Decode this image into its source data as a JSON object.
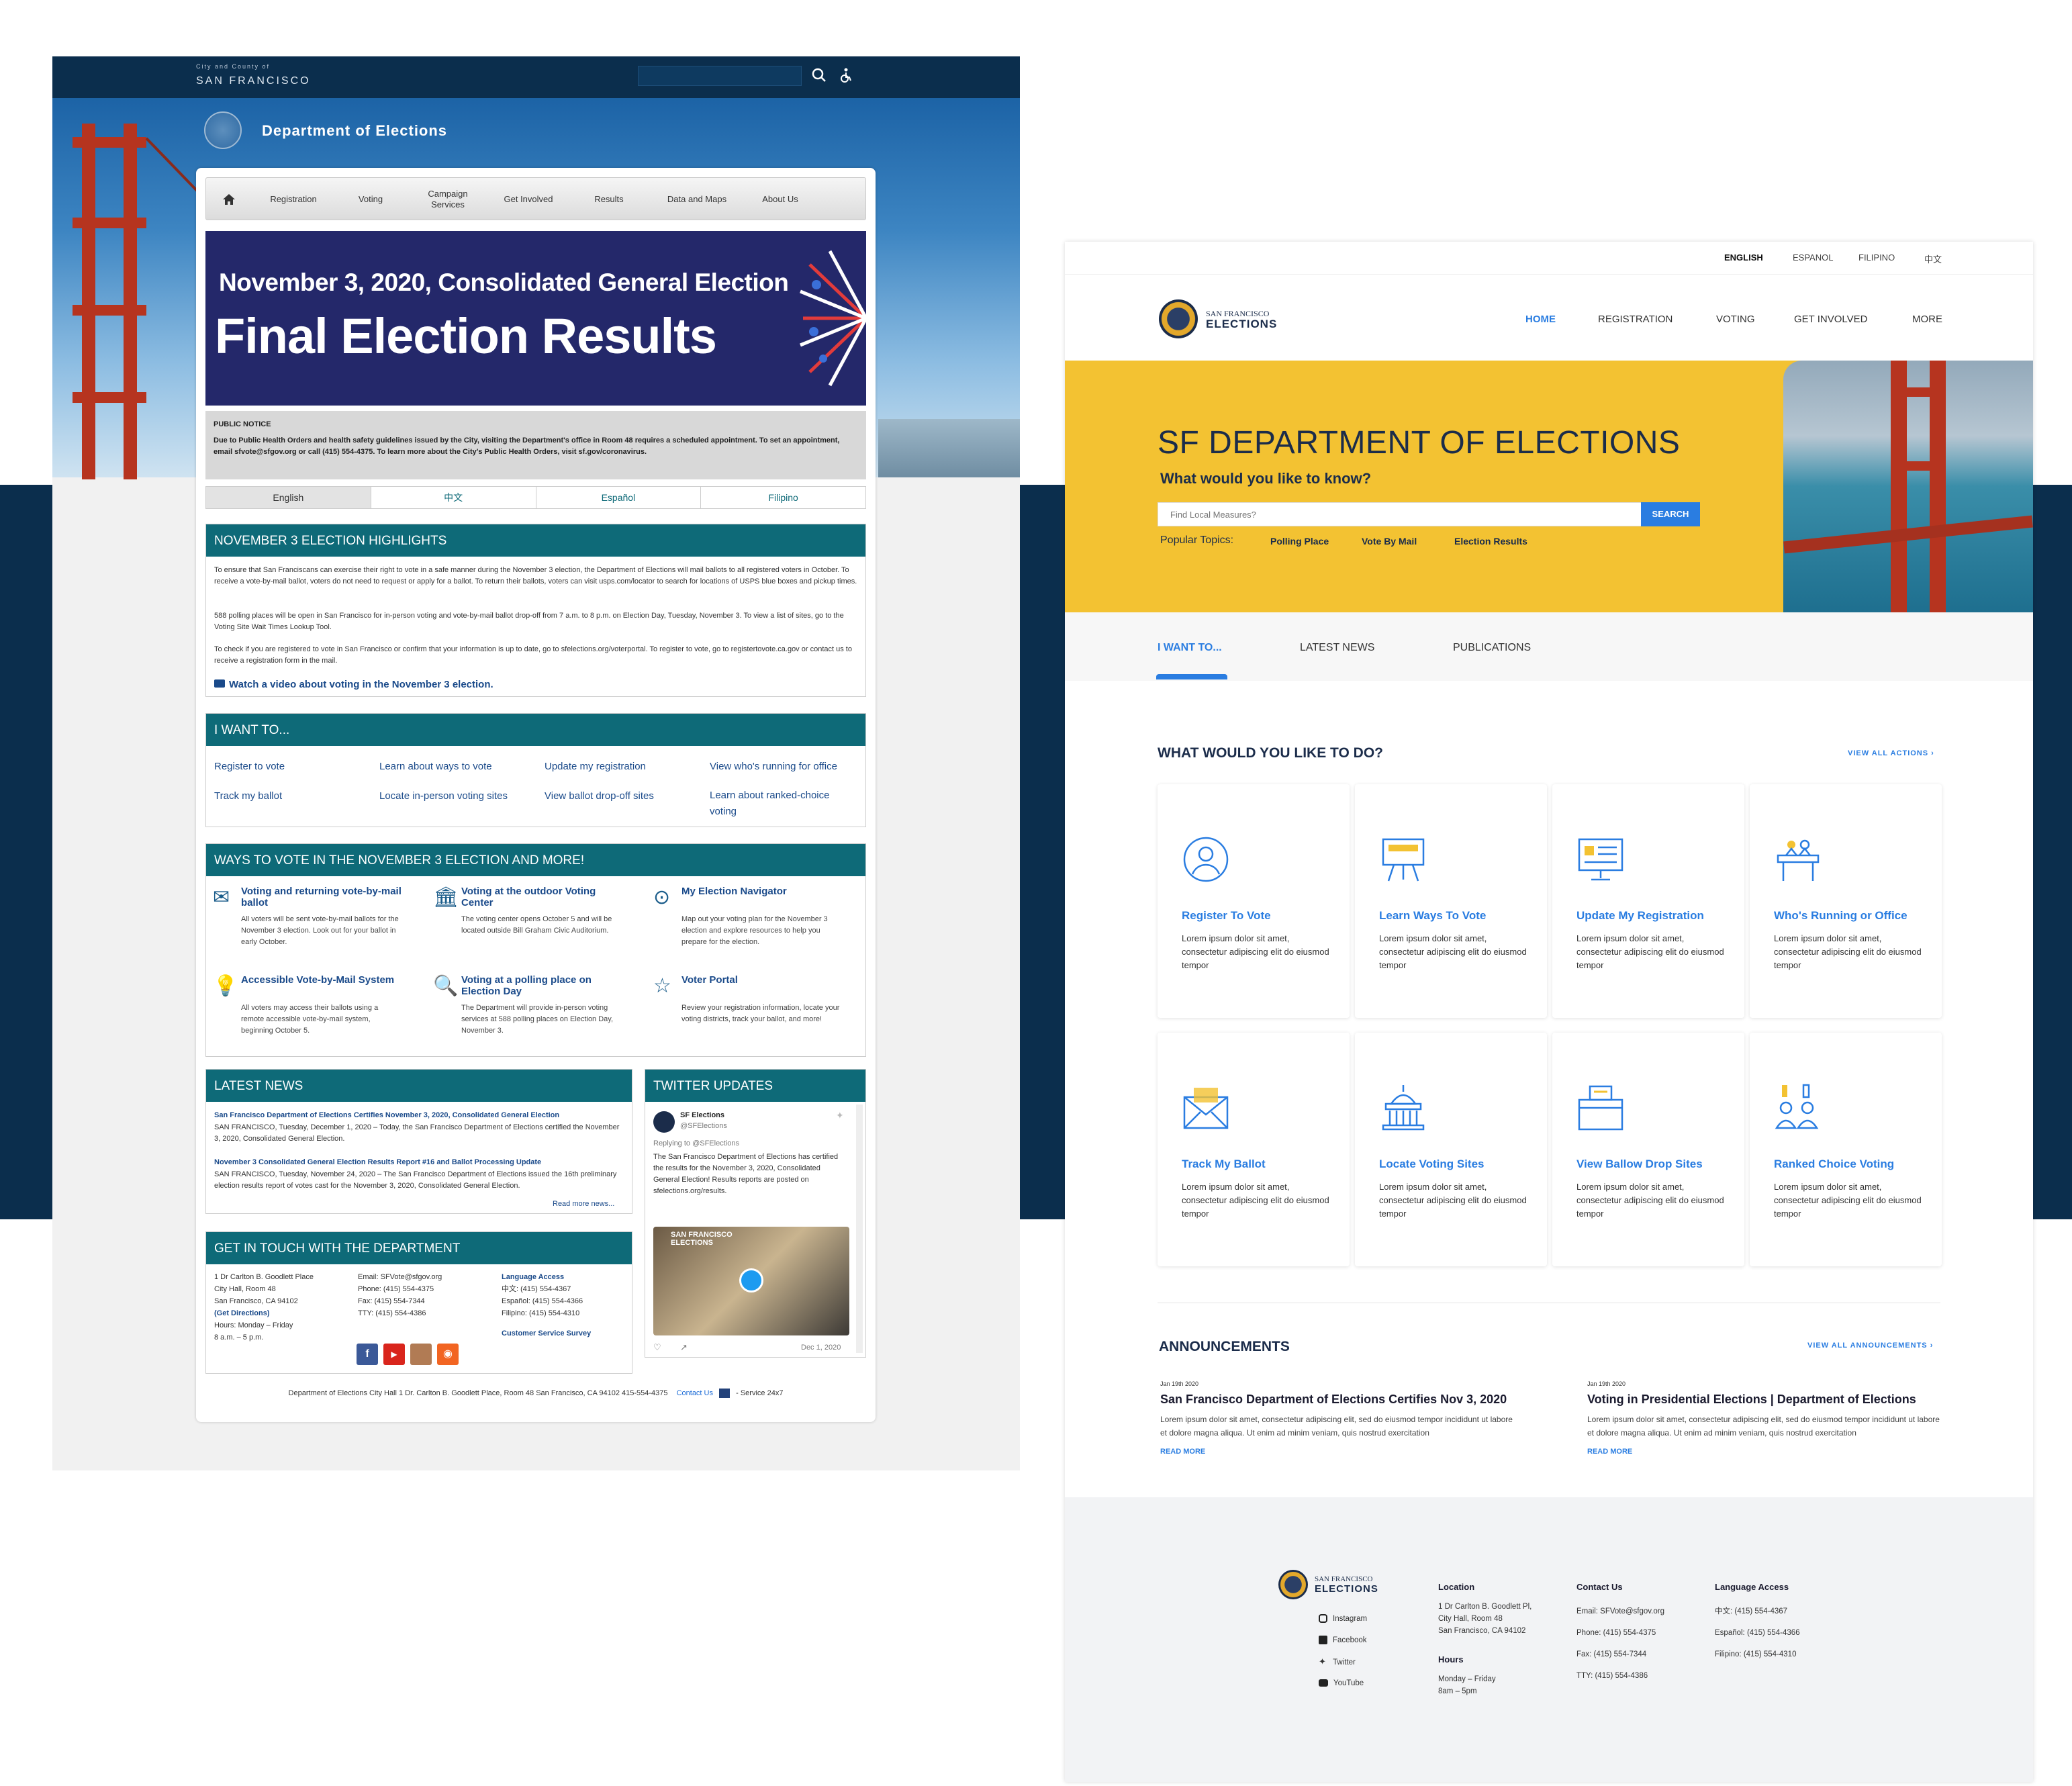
{
  "old_site": {
    "header": {
      "city_small": "City and County of",
      "city_big": "SAN FRANCISCO",
      "dept_title": "Department of Elections"
    },
    "nav": [
      "Registration",
      "Voting",
      "Campaign Services",
      "Get Involved",
      "Results",
      "Data and Maps",
      "About Us"
    ],
    "banner": {
      "line1": "November 3, 2020, Consolidated General Election",
      "line2": "Final Election Results"
    },
    "notice": {
      "title": "PUBLIC NOTICE",
      "text": "Due to Public Health Orders and health safety guidelines issued by the City, visiting the Department's office in Room 48 requires a scheduled appointment. To set an appointment, email sfvote@sfgov.org or call (415) 554-4375. To learn more about the City's Public Health Orders, visit sf.gov/coronavirus."
    },
    "languages": [
      "English",
      "中文",
      "Español",
      "Filipino"
    ],
    "highlights": {
      "title": "NOVEMBER 3 ELECTION HIGHLIGHTS",
      "p1": "To ensure that San Franciscans can exercise their right to vote in a safe manner during the November 3 election, the Department of Elections will mail ballots to all registered voters in October. To receive a vote-by-mail ballot, voters do not need to request or apply for a ballot. To return their ballots, voters can visit usps.com/locator to search for locations of USPS blue boxes and pickup times.",
      "p2": "588 polling places will be open in San Francisco for in-person voting and vote-by-mail ballot drop-off from 7 a.m. to 8 p.m. on Election Day, Tuesday, November 3. To view a list of sites, go to the Voting Site Wait Times Lookup Tool.",
      "p3": "To check if you are registered to vote in San Francisco or confirm that your information is up to date, go to sfelections.org/voterportal. To register to vote, go to registertovote.ca.gov or contact us to receive a registration form in the mail.",
      "video": "Watch a video about voting in the November 3 election."
    },
    "iwant": {
      "title": "I WANT TO...",
      "links": [
        "Register to vote",
        "Learn about ways to vote",
        "Update my registration",
        "View who's running for office",
        "Track my ballot",
        "Locate in-person voting sites",
        "View ballot drop-off sites",
        "Learn about ranked-choice voting"
      ]
    },
    "ways": {
      "title": "WAYS TO VOTE IN THE NOVEMBER 3 ELECTION AND MORE!",
      "items": [
        {
          "title": "Voting and returning vote-by-mail ballot",
          "desc": "All voters will be sent vote-by-mail ballots for the November 3 election. Look out for your ballot in early October.",
          "icon": "✉"
        },
        {
          "title": "Voting at the outdoor Voting Center",
          "desc": "The voting center opens October 5 and will be located outside Bill Graham Civic Auditorium.",
          "icon": "🏛"
        },
        {
          "title": "My Election Navigator",
          "desc": "Map out your voting plan for the November 3 election and explore resources to help you prepare for the election.",
          "icon": "⊙"
        },
        {
          "title": "Accessible Vote-by-Mail System",
          "desc": "All voters may access their ballots using a remote accessible vote-by-mail system, beginning October 5.",
          "icon": "💡"
        },
        {
          "title": "Voting at a polling place on Election Day",
          "desc": "The Department will provide in-person voting services at 588 polling places on Election Day, November 3.",
          "icon": "🔍"
        },
        {
          "title": "Voter Portal",
          "desc": "Review your registration information, locate your voting districts, track your ballot, and more!",
          "icon": "☆"
        }
      ]
    },
    "news": {
      "title": "LATEST NEWS",
      "items": [
        {
          "head": "San Francisco Department of Elections Certifies November 3, 2020, Consolidated General Election",
          "body": "SAN FRANCISCO, Tuesday, December 1, 2020 – Today, the San Francisco Department of Elections certified the November 3, 2020, Consolidated General Election."
        },
        {
          "head": "November 3 Consolidated General Election Results Report #16 and Ballot Processing Update",
          "body": "SAN FRANCISCO, Tuesday, November 24, 2020 – The San Francisco Department of Elections issued the 16th preliminary election results report of votes cast for the November 3, 2020, Consolidated General Election."
        }
      ],
      "more": "Read more news..."
    },
    "twitter": {
      "title": "TWITTER UPDATES",
      "account": "SF Elections",
      "handle": "@SFElections",
      "reply": "Replying to @SFElections",
      "text": "The San Francisco Department of Elections has certified the results for the November 3, 2020, Consolidated General Election! Results reports are posted on sfelections.org/results.",
      "date": "Dec 1, 2020",
      "video_label": "SAN FRANCISCO ELECTIONS"
    },
    "contact": {
      "title": "GET IN TOUCH WITH THE DEPARTMENT",
      "addr": [
        "1 Dr Carlton B. Goodlett Place",
        "City Hall, Room 48",
        "San Francisco, CA 94102",
        "(Get Directions)",
        "Hours: Monday – Friday",
        "8 a.m. – 5 p.m."
      ],
      "phones": [
        "Email: SFVote@sfgov.org",
        "Phone: (415) 554-4375",
        "Fax: (415) 554-7344",
        "TTY: (415) 554-4386"
      ],
      "lang_title": "Language Access",
      "langs": [
        "中文: (415) 554-4367",
        "Español: (415) 554-4366",
        "Filipino: (415) 554-4310"
      ],
      "survey": "Customer Service Survey"
    },
    "footer": {
      "text": "Department of Elections  City Hall   1 Dr. Carlton B. Goodlett Place, Room 48   San Francisco, CA 94102   415-554-4375",
      "contact": "Contact Us",
      "service": "- Service 24x7"
    }
  },
  "new_site": {
    "languages": [
      "ENGLISH",
      "ESPANOL",
      "FILIPINO",
      "中文"
    ],
    "logo": {
      "small": "SAN FRANCISCO",
      "big": "ELECTIONS"
    },
    "nav": [
      "HOME",
      "REGISTRATION",
      "VOTING",
      "GET INVOLVED",
      "MORE"
    ],
    "hero": {
      "title": "SF DEPARTMENT OF ELECTIONS",
      "subtitle": "What would you like to know?",
      "search_placeholder": "Find Local Measures?",
      "search_button": "SEARCH",
      "popular_label": "Popular Topics:",
      "topics": [
        "Polling Place",
        "Vote By Mail",
        "Election Results"
      ]
    },
    "tabs": [
      "I WANT TO...",
      "LATEST NEWS",
      "PUBLICATIONS"
    ],
    "actions": {
      "title": "WHAT WOULD YOU LIKE TO DO?",
      "view_all": "VIEW ALL ACTIONS",
      "cards": [
        {
          "title": "Register To Vote",
          "desc": "Lorem ipsum dolor sit amet, consectetur adipiscing elit do eiusmod tempor"
        },
        {
          "title": "Learn Ways To Vote",
          "desc": "Lorem ipsum dolor sit amet, consectetur adipiscing elit do eiusmod tempor"
        },
        {
          "title": "Update My Registration",
          "desc": "Lorem ipsum dolor sit amet, consectetur adipiscing elit do eiusmod tempor"
        },
        {
          "title": "Who's Running or Office",
          "desc": "Lorem ipsum dolor sit amet, consectetur adipiscing elit do eiusmod tempor"
        },
        {
          "title": "Track My Ballot",
          "desc": "Lorem ipsum dolor sit amet, consectetur adipiscing elit do eiusmod tempor"
        },
        {
          "title": "Locate Voting Sites",
          "desc": "Lorem ipsum dolor sit amet, consectetur adipiscing elit do eiusmod tempor"
        },
        {
          "title": "View Ballow Drop Sites",
          "desc": "Lorem ipsum dolor sit amet, consectetur adipiscing elit do eiusmod tempor"
        },
        {
          "title": "Ranked Choice Voting",
          "desc": "Lorem ipsum dolor sit amet, consectetur adipiscing elit do eiusmod tempor"
        }
      ]
    },
    "announcements": {
      "title": "ANNOUNCEMENTS",
      "view_all": "VIEW ALL ANNOUNCEMENTS",
      "items": [
        {
          "date": "Jan 19th 2020",
          "title": "San Francisco Department of Elections Certifies Nov 3, 2020",
          "desc": "Lorem ipsum dolor sit amet, consectetur adipiscing elit, sed do eiusmod tempor incididunt ut labore et dolore magna aliqua. Ut enim ad minim veniam, quis nostrud exercitation",
          "more": "READ MORE"
        },
        {
          "date": "Jan 19th 2020",
          "title": "Voting in Presidential Elections | Department of Elections",
          "desc": "Lorem ipsum dolor sit amet, consectetur adipiscing elit, sed do eiusmod tempor incididunt ut labore et dolore magna aliqua. Ut enim ad minim veniam, quis nostrud exercitation",
          "more": "READ MORE"
        }
      ]
    },
    "footer": {
      "social": [
        "Instagram",
        "Facebook",
        "Twitter",
        "YouTube"
      ],
      "location_title": "Location",
      "location": [
        "1 Dr Carlton B. Goodlett Pl,",
        "City Hall, Room 48",
        "San Francisco, CA 94102"
      ],
      "hours_title": "Hours",
      "hours": [
        "Monday – Friday",
        "8am – 5pm"
      ],
      "contact_title": "Contact Us",
      "contact": [
        "Email: SFVote@sfgov.org",
        "Phone: (415) 554-4375",
        "Fax: (415) 554-7344",
        "TTY: (415) 554-4386"
      ],
      "lang_title": "Language Access",
      "langs": [
        "中文: (415) 554-4367",
        "Español: (415) 554-4366",
        "Filipino: (415) 554-4310"
      ]
    }
  },
  "colors": {
    "navy": "#0b2e4d",
    "teal": "#0e6a78",
    "yellow": "#f3c232",
    "blue": "#2a7de1",
    "banner": "#24286a"
  }
}
